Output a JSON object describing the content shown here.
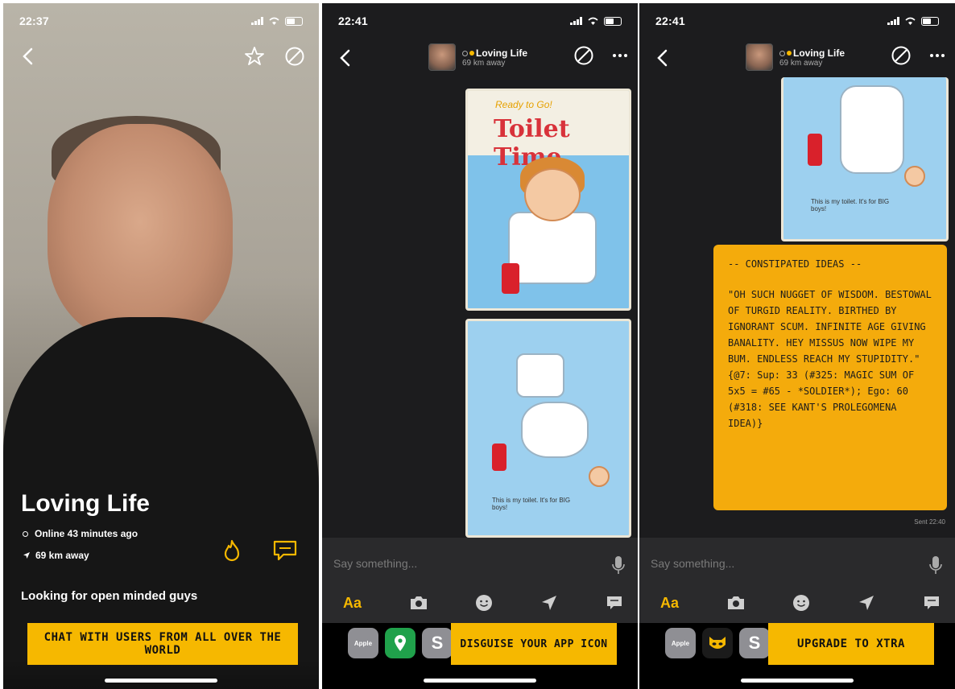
{
  "screens": {
    "profile": {
      "status_time": "22:37",
      "name": "Loving Life",
      "online": "Online 43 minutes ago",
      "distance": "69 km away",
      "bio": "Looking for open minded guys",
      "cta": "CHAT WITH USERS FROM ALL OVER THE WORLD"
    },
    "chat1": {
      "status_time": "22:41",
      "contact_name": "Loving Life",
      "contact_distance": "69 km away",
      "image1_subtitle": "Ready to Go!",
      "image1_title": "Toilet Time",
      "image2_caption": "This is my toilet. It's for BIG boys!",
      "input_placeholder": "Say something...",
      "aa_label": "Aa",
      "app_icon_label": "Apple",
      "ad_cta": "DISGUISE YOUR APP ICON"
    },
    "chat2": {
      "status_time": "22:41",
      "contact_name": "Loving Life",
      "contact_distance": "69 km away",
      "image_caption": "This is my toilet. It's for BIG boys!",
      "message_header": "-- CONSTIPATED IDEAS --",
      "message_body": "\"OH SUCH NUGGET OF WISDOM. BESTOWAL OF TURGID REALITY. BIRTHED BY IGNORANT SCUM. INFINITE AGE GIVING BANALITY. HEY MISSUS NOW WIPE MY BUM. ENDLESS REACH MY STUPIDITY.\" {@7: Sup: 33 (#325: MAGIC SUM OF 5x5 = #65 - *SOLDIER*); Ego: 60 (#318: SEE KANT'S PROLEGOMENA IDEA)}",
      "sent_label": "Sent 22:40",
      "input_placeholder": "Say something...",
      "aa_label": "Aa",
      "app_icon_label": "Apple",
      "ad_cta": "UPGRADE TO XTRA"
    }
  },
  "colors": {
    "brand_yellow": "#f6b800",
    "message_yellow": "#f4ab0c",
    "chat_bg": "#1c1c1e"
  },
  "icons": [
    "back-arrow-icon",
    "star-icon",
    "block-icon",
    "fire-icon",
    "chat-bubble-icon",
    "more-icon",
    "mic-icon",
    "camera-icon",
    "emoji-icon",
    "location-icon",
    "saved-phrases-icon"
  ]
}
